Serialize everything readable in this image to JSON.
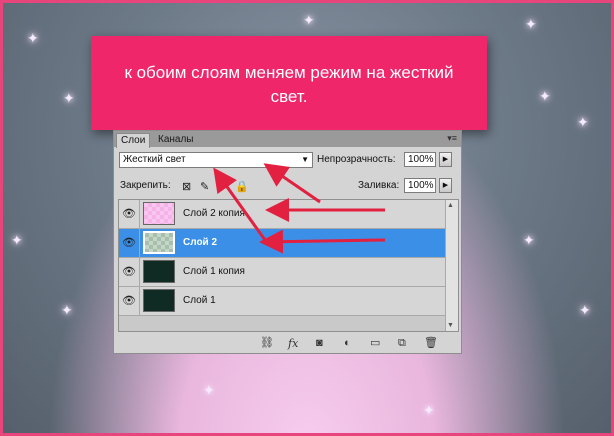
{
  "banner": {
    "text": "к обоим слоям меняем режим на жесткий свет."
  },
  "panel": {
    "tabs": [
      {
        "label": "Слои"
      },
      {
        "label": "Каналы"
      }
    ],
    "blend_mode": "Жесткий свет",
    "opacity_label": "Непрозрачность:",
    "opacity_value": "100%",
    "lock_label": "Закрепить:",
    "fill_label": "Заливка:",
    "fill_value": "100%",
    "layers": [
      {
        "name": "Слой 2 копия"
      },
      {
        "name": "Слой 2"
      },
      {
        "name": "Слой 1 копия"
      },
      {
        "name": "Слой 1"
      }
    ]
  },
  "colors": {
    "banner": "#f0266a",
    "frame_border": "#e8457d",
    "selected_row": "#3b8fe6",
    "arrow": "#e2203f"
  },
  "icons": [
    "eye-icon",
    "lock-transparency-icon",
    "brush-icon",
    "move-icon",
    "lock-all-icon",
    "link-icon",
    "fx-icon",
    "mask-icon",
    "adjustment-icon",
    "folder-icon",
    "new-layer-icon",
    "trash-icon",
    "panel-menu-icon"
  ]
}
